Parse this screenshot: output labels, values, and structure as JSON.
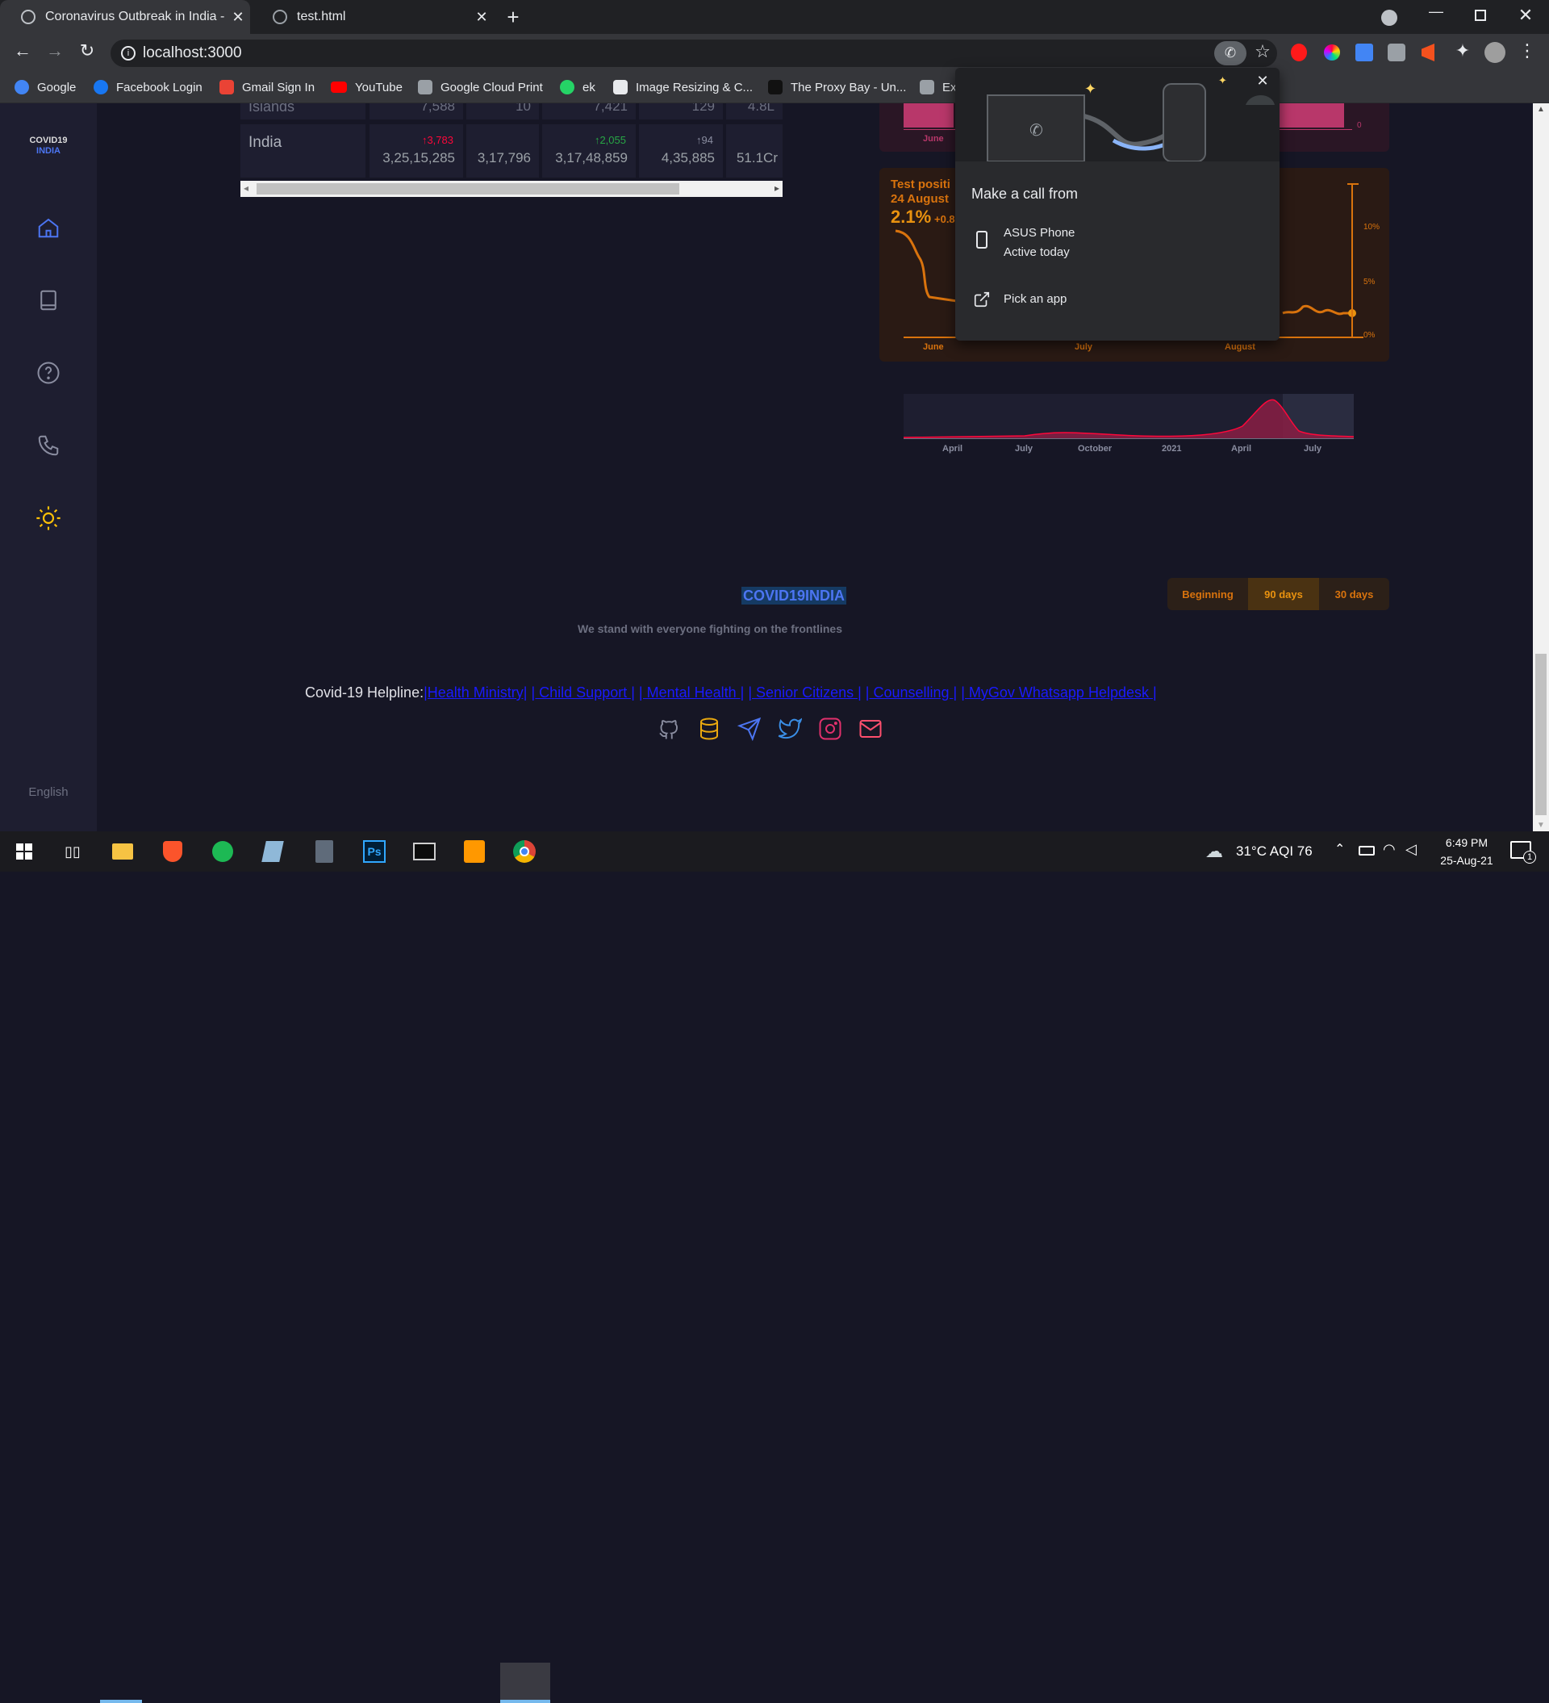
{
  "browser": {
    "tabs": [
      {
        "title": "Coronavirus Outbreak in India - c"
      },
      {
        "title": "test.html"
      }
    ],
    "new_tab_label": "+",
    "url": "localhost:3000",
    "bookmarks": [
      {
        "label": "Google",
        "color": "#4285f4"
      },
      {
        "label": "Facebook Login",
        "color": "#1877f2"
      },
      {
        "label": "Gmail Sign In",
        "color": "#ea4335"
      },
      {
        "label": "YouTube",
        "color": "#ff0000"
      },
      {
        "label": "Google Cloud Print",
        "color": "#9aa0a6"
      },
      {
        "label": "ek",
        "color": "#25d366"
      },
      {
        "label": "Image Resizing & C...",
        "color": "#e8eaed"
      },
      {
        "label": "The Proxy Bay - Un...",
        "color": "#000000"
      },
      {
        "label": "Ex",
        "color": "#9aa0a6"
      }
    ]
  },
  "sidebar": {
    "brand_line1": "COVID19",
    "brand_line2": "INDIA",
    "language": "English"
  },
  "table": {
    "prev_row_label": "Islands",
    "prev_row_values": [
      "7,588",
      "10",
      "7,421",
      "129",
      "4.8L"
    ],
    "row": {
      "name": "India",
      "confirmed_delta": "↑3,783",
      "confirmed": "3,25,15,285",
      "active": "3,17,796",
      "recovered_delta": "↑2,055",
      "recovered": "3,17,48,859",
      "deceased_delta": "↑94",
      "deceased": "4,35,885",
      "tested": "51.1Cr"
    }
  },
  "charts": {
    "top_panel_ticks": [
      "June",
      "0"
    ],
    "tpr_title": "Test positi",
    "tpr_date": "24 August",
    "tpr_value": "2.1%",
    "tpr_delta": "+0.8",
    "tpr_x_ticks": [
      "June",
      "July",
      "August"
    ],
    "tpr_y_ticks": [
      "10%",
      "5%",
      "0%"
    ],
    "brush_ticks": [
      "April",
      "July",
      "October",
      "2021",
      "April",
      "July"
    ]
  },
  "range_buttons": [
    "Beginning",
    "90 days",
    "30 days"
  ],
  "footer": {
    "brand": "COVID19INDIA",
    "tagline": "We stand with everyone fighting on the frontlines",
    "helpline_label": "Covid-19 Helpline:",
    "helpline_links": [
      "|Health Ministry|",
      "| Child Support |",
      "| Mental Health |",
      "| Senior Citizens |",
      "| Counselling |",
      "| MyGov Whatsapp Helpdesk |"
    ]
  },
  "popup": {
    "title": "Make a call from",
    "device_name": "ASUS Phone",
    "device_status": "Active today",
    "pick_app": "Pick an app"
  },
  "taskbar": {
    "weather": "31°C AQI 76",
    "time": "6:49 PM",
    "date": "25-Aug-21",
    "notifications": "1"
  },
  "colors": {
    "accent_blue": "#1a73e8",
    "confirmed_red": "#ff073a",
    "recovered_green": "#28a745",
    "tpr_orange": "#d9730d"
  }
}
